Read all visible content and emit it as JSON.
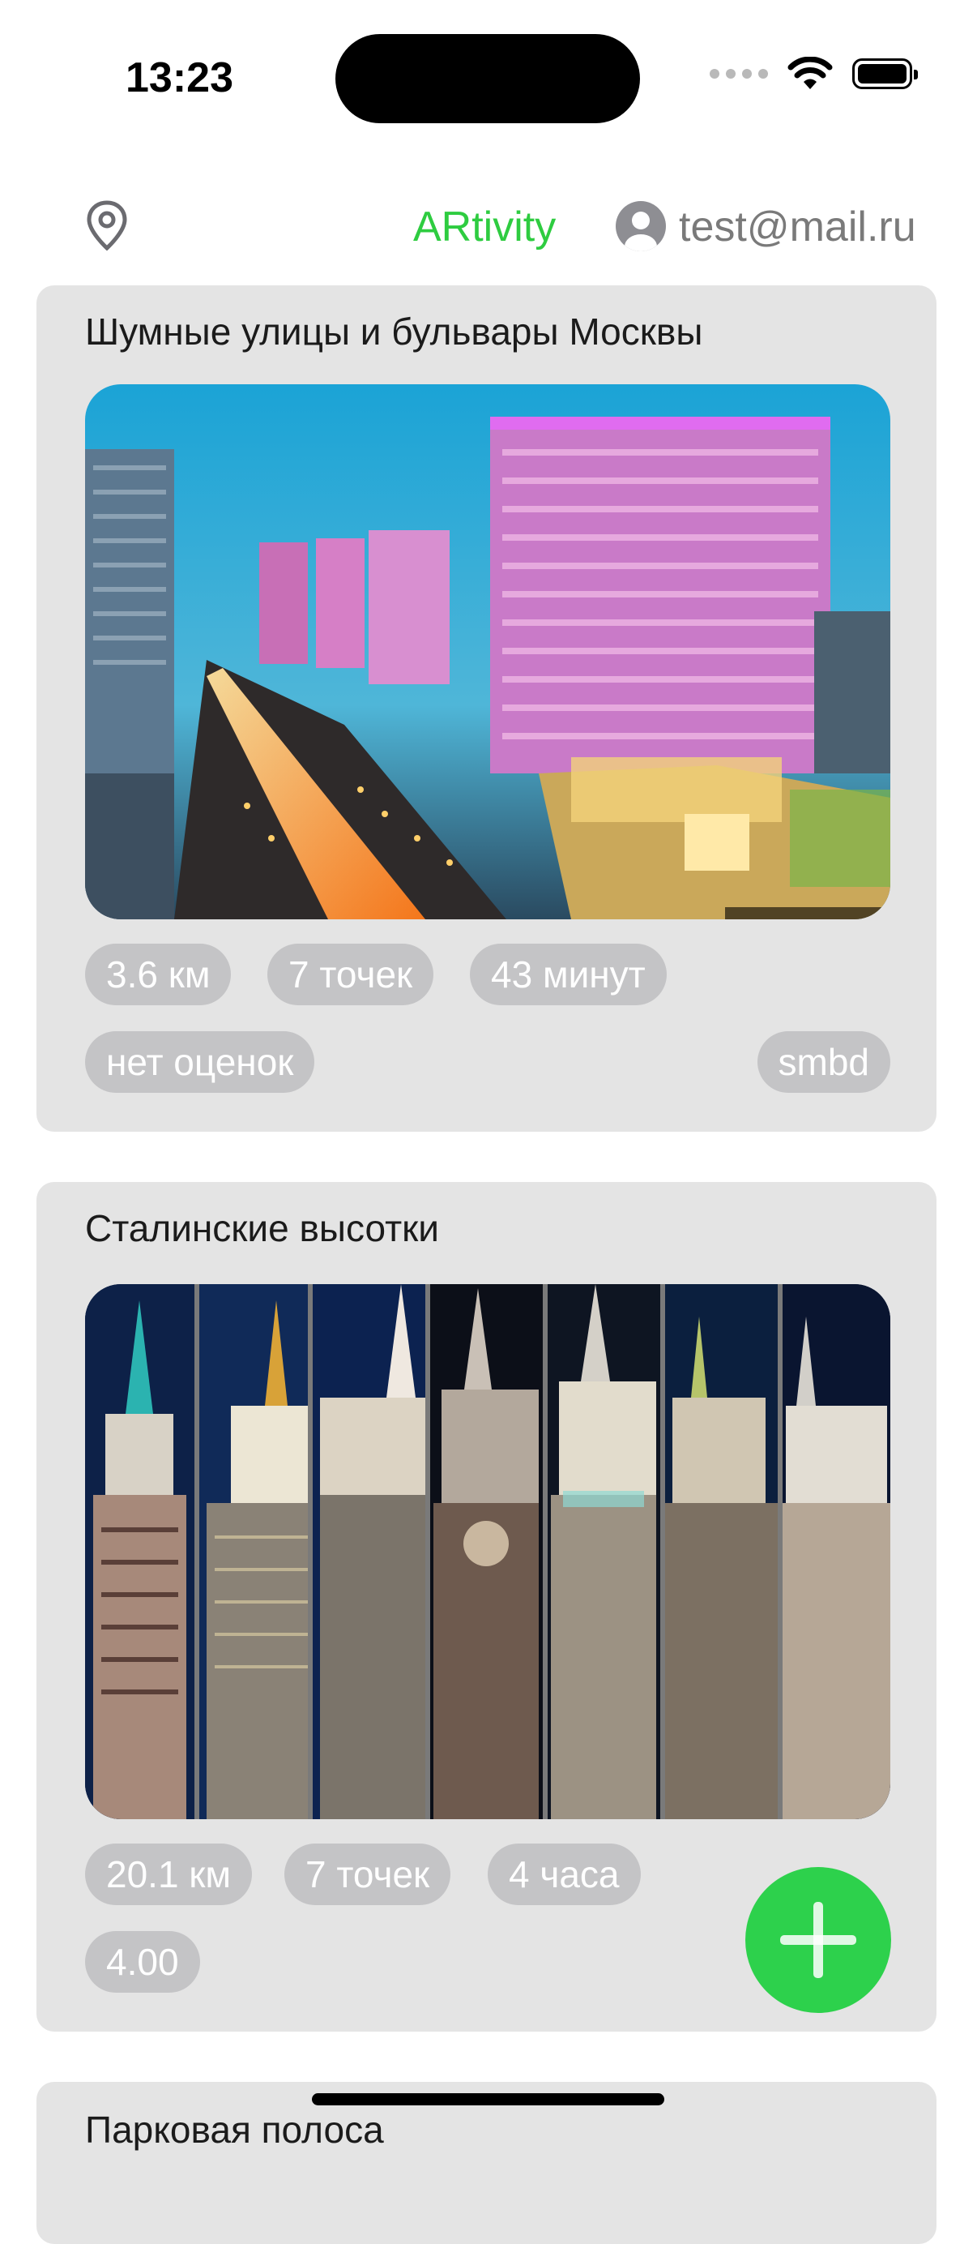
{
  "status_bar": {
    "time": "13:23"
  },
  "header": {
    "title": "ARtivity",
    "user_email": "test@mail.ru"
  },
  "colors": {
    "accent": "#2ecc40",
    "card_bg": "#e4e4e4",
    "chip_bg": "#c4c4c6",
    "fab": "#2dd14c"
  },
  "routes": [
    {
      "title": "Шумные улицы и бульвары Москвы",
      "distance": "3.6 км",
      "points": "7 точек",
      "duration": "43 минут",
      "rating": "нет оценок",
      "author": "smbd"
    },
    {
      "title": "Сталинские высотки",
      "distance": "20.1 км",
      "points": "7 точек",
      "duration": "4 часа",
      "rating": "4.00"
    },
    {
      "title": "Парковая полоса"
    }
  ],
  "icons": {
    "location": "location-pin-icon",
    "profile": "profile-icon",
    "add": "plus-icon",
    "wifi": "wifi-icon",
    "battery": "battery-icon"
  }
}
